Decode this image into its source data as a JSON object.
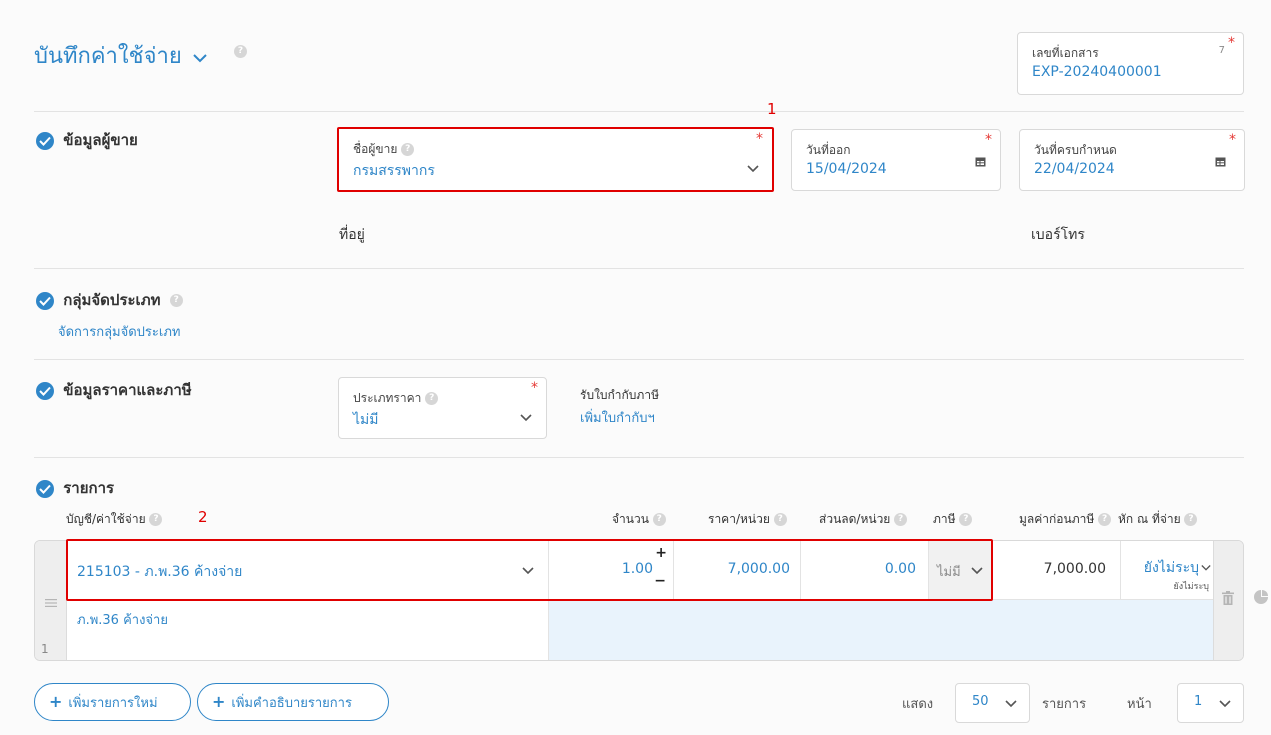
{
  "header": {
    "title": "บันทึกค่าใช้จ่าย",
    "doc_no_label": "เลขที่เอกสาร",
    "doc_no_counter": "7",
    "doc_no_value": "EXP-20240400001"
  },
  "vendor_section": {
    "title": "ข้อมูลผู้ขาย",
    "vendor_label": "ชื่อผู้ขาย",
    "vendor_value": "กรมสรรพากร",
    "issue_date_label": "วันที่ออก",
    "issue_date_value": "15/04/2024",
    "due_date_label": "วันที่ครบกำหนด",
    "due_date_value": "22/04/2024",
    "address_label": "ที่อยู่",
    "phone_label": "เบอร์โทร"
  },
  "category_section": {
    "title": "กลุ่มจัดประเภท",
    "manage_link": "จัดการกลุ่มจัดประเภท"
  },
  "pricing_section": {
    "title": "ข้อมูลราคาและภาษี",
    "price_type_label": "ประเภทราคา",
    "price_type_value": "ไม่มี",
    "tax_invoice_label": "รับใบกำกับภาษี",
    "tax_invoice_link": "เพิ่มใบกำกับฯ"
  },
  "items_section": {
    "title": "รายการ",
    "columns": {
      "account": "บัญชี/ค่าใช้จ่าย",
      "qty": "จำนวน",
      "unit_price": "ราคา/หน่วย",
      "discount": "ส่วนลด/หน่วย",
      "tax": "ภาษี",
      "pre_tax": "มูลค่าก่อนภาษี",
      "withholding": "หัก ณ ที่จ่าย"
    },
    "rows": [
      {
        "index": "1",
        "account": "215103 - ภ.พ.36 ค้างจ่าย",
        "description": "ภ.พ.36 ค้างจ่าย",
        "qty": "1.00",
        "unit_price": "7,000.00",
        "discount": "0.00",
        "tax": "ไม่มี",
        "pre_tax": "7,000.00",
        "withholding": "ยังไม่ระบุ",
        "withholding_sub": "ยังไม่ระบุ"
      }
    ]
  },
  "footer": {
    "add_item": "เพิ่มรายการใหม่",
    "add_description": "เพิ่มคำอธิบายรายการ",
    "show_label": "แสดง",
    "page_size": "50",
    "items_label": "รายการ",
    "page_label": "หน้า",
    "page_value": "1"
  },
  "annotations": {
    "box1": "1",
    "box2": "2"
  },
  "colors": {
    "accent": "#2f86c8",
    "required": "#e53935",
    "highlight": "#e00000",
    "row_fill": "#e9f3fc"
  }
}
